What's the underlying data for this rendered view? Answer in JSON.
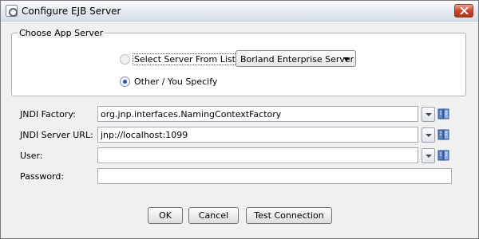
{
  "window": {
    "title": "Configure EJB Server",
    "icon": "server-config-icon",
    "close_icon": "close-icon"
  },
  "app_server_group": {
    "title": "Choose App Server",
    "options": [
      {
        "label": "Select Server From List:",
        "selected": false
      },
      {
        "label": "Other / You Specify",
        "selected": true
      }
    ],
    "server_list": {
      "selected": "Borland Enterprise Server",
      "icon": "chevron-down-icon"
    }
  },
  "fields": {
    "jndi_factory": {
      "label": "JNDI Factory:",
      "value": "org.jnp.interfaces.NamingContextFactory"
    },
    "jndi_server_url": {
      "label": "JNDI Server URL:",
      "value": "jnp://localhost:1099"
    },
    "user": {
      "label": "User:",
      "value": ""
    },
    "password": {
      "label": "Password:",
      "value": ""
    }
  },
  "buttons": {
    "ok": "OK",
    "cancel": "Cancel",
    "test_connection": "Test Connection"
  },
  "colors": {
    "window_bg": "#f0f0f0",
    "close_button": "#c9462c",
    "radio_selected": "#1f57b0"
  }
}
